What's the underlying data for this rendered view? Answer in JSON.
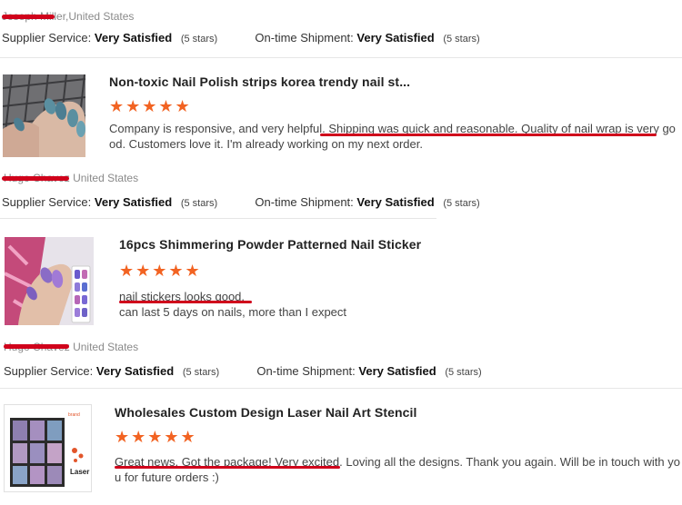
{
  "reviews": [
    {
      "reviewer_name": "Joseph Miller",
      "reviewer_country": ",United States",
      "supplier_label": "Supplier Service:",
      "supplier_value": "Very Satisfied",
      "supplier_stars": "(5 stars)",
      "shipment_label": "On-time Shipment:",
      "shipment_value": "Very Satisfied",
      "shipment_stars": "(5 stars)"
    },
    {
      "product_title": "Non-toxic Nail Polish strips korea trendy nail st...",
      "rating": 5,
      "comment_part1": "Company is responsive, and very helpful. ",
      "comment_highlight": "Shipping was quick and reasonable. Quality of nail wrap is very go",
      "comment_line2": "od.  Customers love it.  I'm already working on my next order.",
      "reviewer_name": "Hugo Chavez",
      "reviewer_country": "United States",
      "supplier_label": "Supplier Service:",
      "supplier_value": "Very Satisfied",
      "supplier_stars": "(5 stars)",
      "shipment_label": "On-time Shipment:",
      "shipment_value": "Very Satisfied",
      "shipment_stars": "(5 stars)"
    },
    {
      "product_title": "16pcs Shimmering Powder Patterned Nail Sticker",
      "rating": 5,
      "comment_highlight": "nail stickers looks good",
      "comment_part2": ".",
      "comment_line2": "can last 5 days on nails, more than I expect",
      "reviewer_name": "Hugo Chavez",
      "reviewer_country": "United States",
      "supplier_label": "Supplier Service:",
      "supplier_value": "Very Satisfied",
      "supplier_stars": "(5 stars)",
      "shipment_label": "On-time Shipment:",
      "shipment_value": "Very Satisfied",
      "shipment_stars": "(5 stars)"
    },
    {
      "product_title": "Wholesales Custom Design Laser Nail Art Stencil",
      "rating": 5,
      "comment_highlight": "Great news. Got the package! Very excited.",
      "comment_part2": " Loving all the designs. Thank you again. Will be in touch with yo",
      "comment_line2": "u for future orders :)",
      "thumb_label": "Laser"
    }
  ],
  "star_glyph": "★★★★★",
  "colors": {
    "star": "#f26322",
    "redaction": "#d0021b"
  }
}
